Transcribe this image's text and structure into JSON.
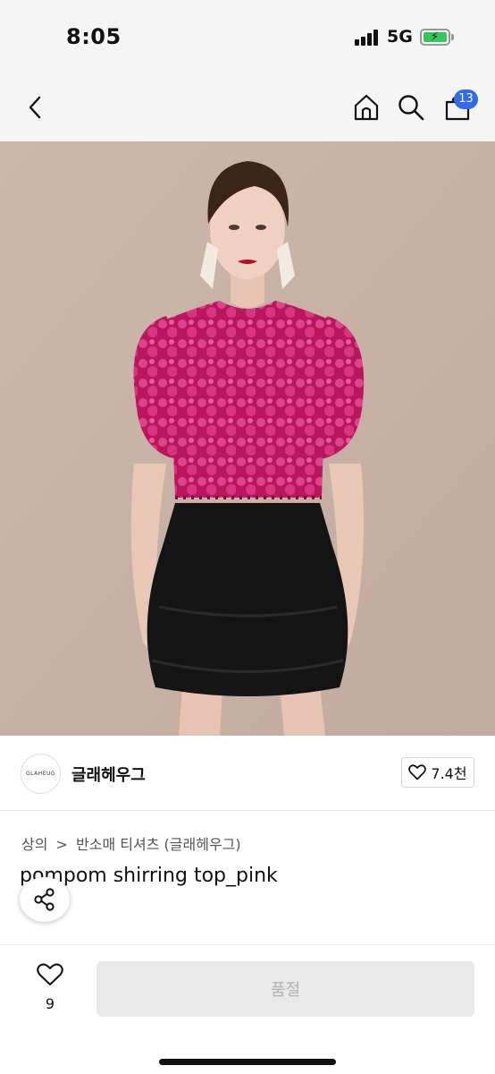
{
  "status_bar": {
    "time": "8:05",
    "network": "5G",
    "battery_level": 1.0,
    "battery_color": "#34c759"
  },
  "nav": {
    "back_icon": "chevron-left-icon",
    "home_icon": "home-icon",
    "search_icon": "search-icon",
    "cart_icon": "shopping-bag-icon",
    "cart_badge": "13",
    "badge_color": "#2f6bea"
  },
  "hero": {
    "image_alt": "",
    "logo_text": "GLAHEUG"
  },
  "brand": {
    "logo_text": "GLAHEUG",
    "name": "글래헤우그",
    "likes": "7.4천",
    "like_icon": "heart-outline-icon"
  },
  "breadcrumb": {
    "category": "상의",
    "separator": ">",
    "subcategory": "반소매 티셔츠 (글래헤우그)"
  },
  "product": {
    "title": "pompom shirring top_pink"
  },
  "share": {
    "icon": "share-icon"
  },
  "bottom_bar": {
    "wish_icon": "heart-outline-icon",
    "wish_count": "9",
    "cta_label": "품절"
  }
}
